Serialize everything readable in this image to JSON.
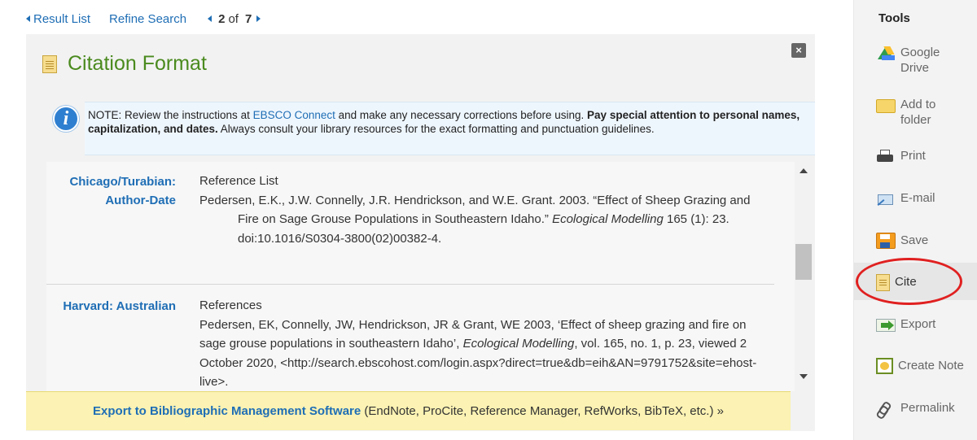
{
  "nav": {
    "result_list": "Result List",
    "refine_search": "Refine Search",
    "current": "2",
    "of": "of",
    "total": "7"
  },
  "panel": {
    "title": "Citation Format",
    "close": "×",
    "note": {
      "prefix": "NOTE: Review the instructions at ",
      "link": "EBSCO Connect",
      "middle": " and make any necessary corrections before using. ",
      "bold": "Pay special attention to personal names, capitalization, and dates.",
      "suffix": " Always consult your library resources for the exact formatting and punctuation guidelines."
    },
    "citations": [
      {
        "style_line1": "Chicago/Turabian:",
        "style_line2": "Author-Date",
        "heading": "Reference List",
        "text_a": "Pedersen, E.K., J.W. Connelly, J.R. Hendrickson, and W.E. Grant. 2003. “Effect of Sheep Grazing and Fire on Sage Grouse Populations in Southeastern Idaho.” ",
        "journal": "Ecological Modelling",
        "text_b": " 165 (1): 23. doi:10.1016/S0304-3800(02)00382-4."
      },
      {
        "style_line1": "Harvard: Australian",
        "heading": "References",
        "text_a": "Pedersen, EK, Connelly, JW, Hendrickson, JR & Grant, WE 2003, ‘Effect of sheep grazing and fire on sage grouse populations in southeastern Idaho’, ",
        "journal": "Ecological Modelling",
        "text_b": ", vol. 165, no. 1, p. 23, viewed 2 October 2020, <http://search.ebscohost.com/login.aspx?direct=true&db=eih&AN=9791752&site=ehost-live>."
      }
    ],
    "export": {
      "link": "Export to Bibliographic Management Software",
      "rest": " (EndNote, ProCite, Reference Manager, RefWorks, BibTeX, etc.) »"
    }
  },
  "tools": {
    "title": "Tools",
    "items": [
      {
        "label": "Google Drive",
        "icon": "google-drive-icon"
      },
      {
        "label": "Add to folder",
        "icon": "folder-icon"
      },
      {
        "label": "Print",
        "icon": "printer-icon"
      },
      {
        "label": "E-mail",
        "icon": "email-icon"
      },
      {
        "label": "Save",
        "icon": "save-icon"
      },
      {
        "label": "Cite",
        "icon": "cite-icon"
      },
      {
        "label": "Export",
        "icon": "export-icon"
      },
      {
        "label": "Create Note",
        "icon": "note-icon"
      },
      {
        "label": "Permalink",
        "icon": "link-icon"
      }
    ],
    "highlight_color": "#e02020"
  }
}
